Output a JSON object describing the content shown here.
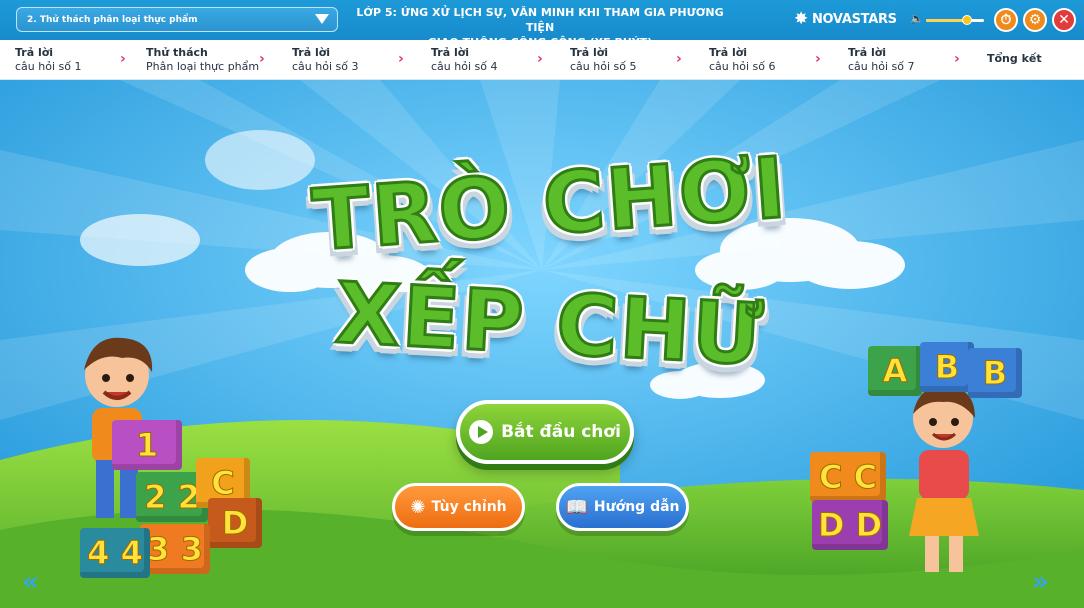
{
  "topbar": {
    "lesson_select": "2. Thử thách phân loại thực phẩm",
    "lesson_title_1": "LỚP 5:  ỨNG XỬ LỊCH SỰ, VĂN MINH KHI THAM GIA PHƯƠNG TIỆN",
    "lesson_title_2": "GIAO THÔNG CÔNG CỘNG (XE BUÝT)",
    "brand": "NOVASTARS",
    "volume_level": 0.7
  },
  "steps": [
    {
      "l1": "Trả lời",
      "l2": "câu hỏi số 1"
    },
    {
      "l1": "Thử thách",
      "l2": "Phân loại thực phẩm"
    },
    {
      "l1": "Trả lời",
      "l2": "câu hỏi số 3"
    },
    {
      "l1": "Trả lời",
      "l2": "câu hỏi số 4"
    },
    {
      "l1": "Trả lời",
      "l2": "câu hỏi số 5"
    },
    {
      "l1": "Trả lời",
      "l2": "câu hỏi số 6"
    },
    {
      "l1": "Trả lời",
      "l2": "câu hỏi số 7"
    },
    {
      "l1": "Tổng kết",
      "l2": ""
    }
  ],
  "game": {
    "title_line1": "TRÒ CHƠI",
    "title_line2": "XẾP CHỮ",
    "play_label": "Bắt đầu chơi",
    "custom_label": "Tùy chỉnh",
    "guide_label": "Hướng dẫn"
  },
  "blocks_left": [
    "1",
    "2",
    "2",
    "C",
    "D",
    "3",
    "3",
    "4",
    "4"
  ],
  "blocks_right_top": [
    "A",
    "B",
    "B"
  ],
  "blocks_right": [
    "C",
    "C",
    "D",
    "D"
  ],
  "colors": {
    "topbar": "#178bcb",
    "title_green": "#5bbd2a",
    "play": "#4fa520",
    "custom": "#ee6d12",
    "guide": "#2a6fd0"
  }
}
